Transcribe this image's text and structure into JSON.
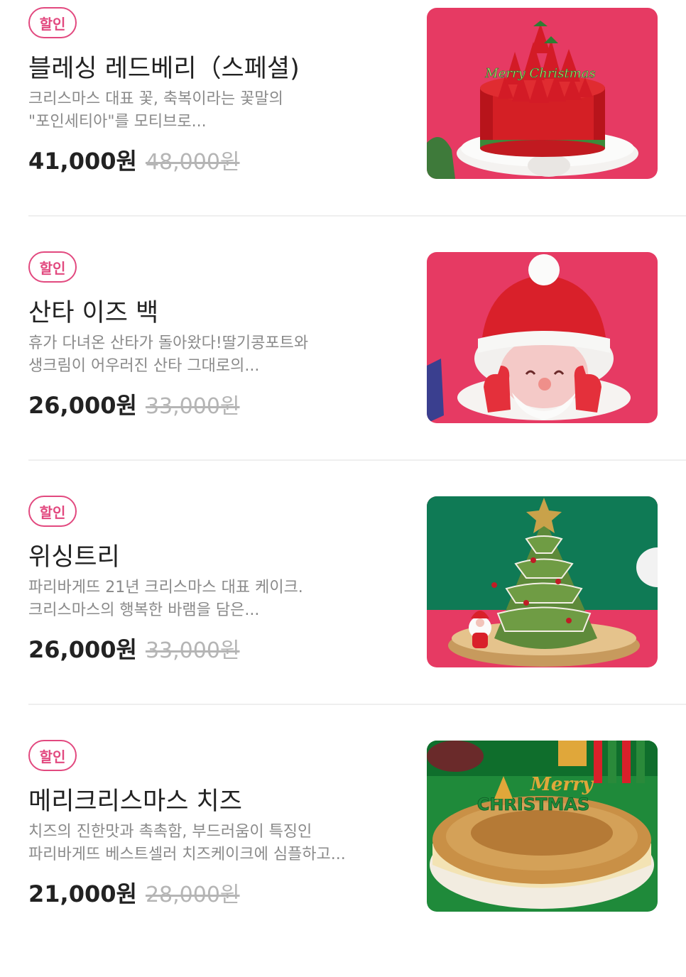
{
  "items": [
    {
      "badge": "할인",
      "title": "블레싱 레드베리（스페셜)",
      "desc_line1": "크리스마스 대표 꽃, 축복이라는 꽃말의",
      "desc_line2": "\"포인세티아\"를 모티브로...",
      "price": "41,000원",
      "original_price": "48,000원",
      "image_icon": "strawberry-cake-image",
      "topper_text": "Merry Christmas"
    },
    {
      "badge": "할인",
      "title": "산타 이즈 백",
      "desc_line1": "휴가 다녀온 산타가 돌아왔다!딸기콩포트와",
      "desc_line2": "생크림이 어우러진 산타 그대로의...",
      "price": "26,000원",
      "original_price": "33,000원",
      "image_icon": "santa-cake-image"
    },
    {
      "badge": "할인",
      "title": "위싱트리",
      "desc_line1": "파리바게뜨 21년 크리스마스 대표 케이크.",
      "desc_line2": "크리스마스의 행복한 바램을 담은...",
      "price": "26,000원",
      "original_price": "33,000원",
      "image_icon": "tree-cake-image"
    },
    {
      "badge": "할인",
      "title": "메리크리스마스 치즈",
      "desc_line1": "치즈의 진한맛과 촉촉함, 부드러움이 특징인",
      "desc_line2": "파리바게뜨 베스트셀러 치즈케이크에 심플하고...",
      "price": "21,000원",
      "original_price": "28,000원",
      "image_icon": "cheesecake-image",
      "topper_line1": "Merry",
      "topper_line2": "CHRISTMAS"
    }
  ],
  "colors": {
    "accent": "#e2497f",
    "text": "#222222",
    "muted": "#8a8a8a",
    "strike": "#b5b5b5"
  }
}
